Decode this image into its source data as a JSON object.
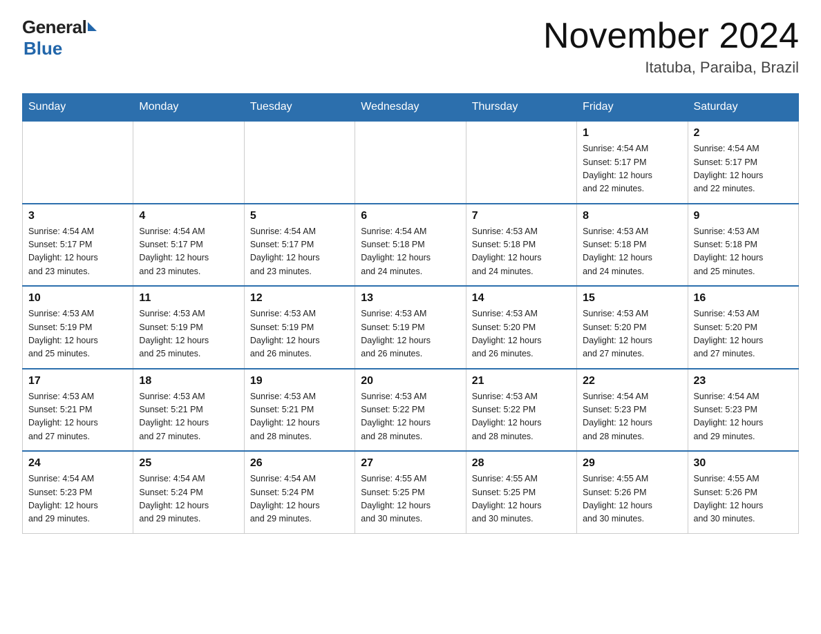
{
  "header": {
    "logo_general": "General",
    "logo_blue": "Blue",
    "month_title": "November 2024",
    "location": "Itatuba, Paraiba, Brazil"
  },
  "days_of_week": [
    "Sunday",
    "Monday",
    "Tuesday",
    "Wednesday",
    "Thursday",
    "Friday",
    "Saturday"
  ],
  "weeks": [
    [
      {
        "day": "",
        "info": ""
      },
      {
        "day": "",
        "info": ""
      },
      {
        "day": "",
        "info": ""
      },
      {
        "day": "",
        "info": ""
      },
      {
        "day": "",
        "info": ""
      },
      {
        "day": "1",
        "info": "Sunrise: 4:54 AM\nSunset: 5:17 PM\nDaylight: 12 hours\nand 22 minutes."
      },
      {
        "day": "2",
        "info": "Sunrise: 4:54 AM\nSunset: 5:17 PM\nDaylight: 12 hours\nand 22 minutes."
      }
    ],
    [
      {
        "day": "3",
        "info": "Sunrise: 4:54 AM\nSunset: 5:17 PM\nDaylight: 12 hours\nand 23 minutes."
      },
      {
        "day": "4",
        "info": "Sunrise: 4:54 AM\nSunset: 5:17 PM\nDaylight: 12 hours\nand 23 minutes."
      },
      {
        "day": "5",
        "info": "Sunrise: 4:54 AM\nSunset: 5:17 PM\nDaylight: 12 hours\nand 23 minutes."
      },
      {
        "day": "6",
        "info": "Sunrise: 4:54 AM\nSunset: 5:18 PM\nDaylight: 12 hours\nand 24 minutes."
      },
      {
        "day": "7",
        "info": "Sunrise: 4:53 AM\nSunset: 5:18 PM\nDaylight: 12 hours\nand 24 minutes."
      },
      {
        "day": "8",
        "info": "Sunrise: 4:53 AM\nSunset: 5:18 PM\nDaylight: 12 hours\nand 24 minutes."
      },
      {
        "day": "9",
        "info": "Sunrise: 4:53 AM\nSunset: 5:18 PM\nDaylight: 12 hours\nand 25 minutes."
      }
    ],
    [
      {
        "day": "10",
        "info": "Sunrise: 4:53 AM\nSunset: 5:19 PM\nDaylight: 12 hours\nand 25 minutes."
      },
      {
        "day": "11",
        "info": "Sunrise: 4:53 AM\nSunset: 5:19 PM\nDaylight: 12 hours\nand 25 minutes."
      },
      {
        "day": "12",
        "info": "Sunrise: 4:53 AM\nSunset: 5:19 PM\nDaylight: 12 hours\nand 26 minutes."
      },
      {
        "day": "13",
        "info": "Sunrise: 4:53 AM\nSunset: 5:19 PM\nDaylight: 12 hours\nand 26 minutes."
      },
      {
        "day": "14",
        "info": "Sunrise: 4:53 AM\nSunset: 5:20 PM\nDaylight: 12 hours\nand 26 minutes."
      },
      {
        "day": "15",
        "info": "Sunrise: 4:53 AM\nSunset: 5:20 PM\nDaylight: 12 hours\nand 27 minutes."
      },
      {
        "day": "16",
        "info": "Sunrise: 4:53 AM\nSunset: 5:20 PM\nDaylight: 12 hours\nand 27 minutes."
      }
    ],
    [
      {
        "day": "17",
        "info": "Sunrise: 4:53 AM\nSunset: 5:21 PM\nDaylight: 12 hours\nand 27 minutes."
      },
      {
        "day": "18",
        "info": "Sunrise: 4:53 AM\nSunset: 5:21 PM\nDaylight: 12 hours\nand 27 minutes."
      },
      {
        "day": "19",
        "info": "Sunrise: 4:53 AM\nSunset: 5:21 PM\nDaylight: 12 hours\nand 28 minutes."
      },
      {
        "day": "20",
        "info": "Sunrise: 4:53 AM\nSunset: 5:22 PM\nDaylight: 12 hours\nand 28 minutes."
      },
      {
        "day": "21",
        "info": "Sunrise: 4:53 AM\nSunset: 5:22 PM\nDaylight: 12 hours\nand 28 minutes."
      },
      {
        "day": "22",
        "info": "Sunrise: 4:54 AM\nSunset: 5:23 PM\nDaylight: 12 hours\nand 28 minutes."
      },
      {
        "day": "23",
        "info": "Sunrise: 4:54 AM\nSunset: 5:23 PM\nDaylight: 12 hours\nand 29 minutes."
      }
    ],
    [
      {
        "day": "24",
        "info": "Sunrise: 4:54 AM\nSunset: 5:23 PM\nDaylight: 12 hours\nand 29 minutes."
      },
      {
        "day": "25",
        "info": "Sunrise: 4:54 AM\nSunset: 5:24 PM\nDaylight: 12 hours\nand 29 minutes."
      },
      {
        "day": "26",
        "info": "Sunrise: 4:54 AM\nSunset: 5:24 PM\nDaylight: 12 hours\nand 29 minutes."
      },
      {
        "day": "27",
        "info": "Sunrise: 4:55 AM\nSunset: 5:25 PM\nDaylight: 12 hours\nand 30 minutes."
      },
      {
        "day": "28",
        "info": "Sunrise: 4:55 AM\nSunset: 5:25 PM\nDaylight: 12 hours\nand 30 minutes."
      },
      {
        "day": "29",
        "info": "Sunrise: 4:55 AM\nSunset: 5:26 PM\nDaylight: 12 hours\nand 30 minutes."
      },
      {
        "day": "30",
        "info": "Sunrise: 4:55 AM\nSunset: 5:26 PM\nDaylight: 12 hours\nand 30 minutes."
      }
    ]
  ]
}
